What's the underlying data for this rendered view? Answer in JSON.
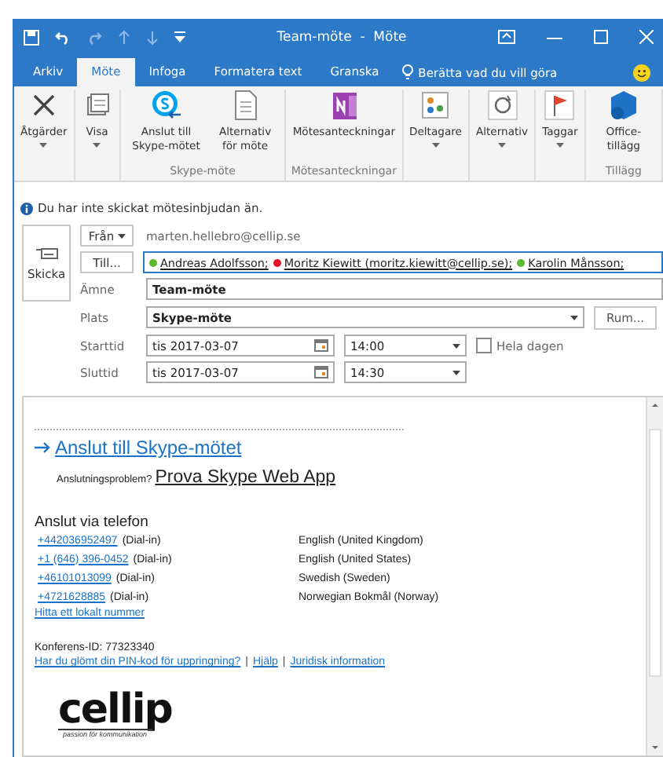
{
  "window": {
    "title": "Team-möte  -  Möte"
  },
  "tabs": [
    {
      "label": "Arkiv",
      "selected": false
    },
    {
      "label": "Möte",
      "selected": true
    },
    {
      "label": "Infoga",
      "selected": false
    },
    {
      "label": "Formatera text",
      "selected": false
    },
    {
      "label": "Granska",
      "selected": false
    }
  ],
  "tell_me": "Berätta vad du vill göra",
  "ribbon": [
    {
      "buttons": [
        {
          "label": "Åtgärder",
          "dropdown": true
        }
      ]
    },
    {
      "buttons": [
        {
          "label": "Visa",
          "dropdown": true
        }
      ]
    },
    {
      "label": "Skype-möte",
      "buttons": [
        {
          "label": "Anslut till Skype-mötet",
          "dropdown": false
        },
        {
          "label": "Alternativ för möte",
          "dropdown": false
        }
      ]
    },
    {
      "label": "Mötesanteckningar",
      "buttons": [
        {
          "label": "Mötesanteckningar",
          "dropdown": false
        }
      ]
    },
    {
      "buttons": [
        {
          "label": "Deltagare",
          "dropdown": true
        }
      ]
    },
    {
      "buttons": [
        {
          "label": "Alternativ",
          "dropdown": true
        }
      ]
    },
    {
      "buttons": [
        {
          "label": "Taggar",
          "dropdown": true
        }
      ]
    },
    {
      "label": "Tillägg",
      "buttons": [
        {
          "label": "Office-tillägg",
          "dropdown": false
        }
      ]
    }
  ],
  "info": "Du har inte skickat mötesinbjudan än.",
  "send_button": "Skicka",
  "from": {
    "label": "Från",
    "value": "marten.hellebro@cellip.se"
  },
  "to": {
    "label": "Till...",
    "recipients": [
      {
        "name": "Andreas Adolfsson;",
        "color": "#5cb82e"
      },
      {
        "name": "Moritz Kiewitt (moritz.kiewitt@cellip.se);",
        "color": "#e81123"
      },
      {
        "name": "Karolin Månsson;",
        "color": "#5cb82e"
      }
    ]
  },
  "subject": {
    "label": "Ämne",
    "value": "Team-möte"
  },
  "location": {
    "label": "Plats",
    "value": "Skype-möte",
    "button": "Rum..."
  },
  "start": {
    "label": "Starttid",
    "date": "tis 2017-03-07",
    "time": "14:00"
  },
  "end": {
    "label": "Sluttid",
    "date": "tis 2017-03-07",
    "time": "14:30"
  },
  "all_day": {
    "label": "Hela dagen",
    "checked": false
  },
  "body": {
    "join_link": "Anslut till Skype-mötet",
    "trouble": "Anslutningsproblem?",
    "web_app": "Prova Skype Web App",
    "phone_heading": "Anslut via telefon",
    "numbers": [
      {
        "number": "+442036952497",
        "suffix": "(Dial-in)",
        "language": "English (United Kingdom)"
      },
      {
        "number": "+1 (646) 396-0452",
        "suffix": "(Dial-in)",
        "language": "English (United States)"
      },
      {
        "number": "+46101013099",
        "suffix": "(Dial-in)",
        "language": "Swedish (Sweden)"
      },
      {
        "number": "+4721628885",
        "suffix": "(Dial-in)",
        "language": "Norwegian Bokmål (Norway)"
      }
    ],
    "local_link": "Hitta ett lokalt nummer",
    "conference_id": "Konferens-ID: 77323340",
    "links": [
      {
        "text": "Har du glömt din PIN-kod för uppringning?"
      },
      {
        "separator": "|",
        "text": "Hjälp"
      },
      {
        "separator": "|",
        "text": "Juridisk information"
      }
    ],
    "logo": {
      "name": "cellip",
      "tagline": "passion för kommunikation"
    }
  }
}
